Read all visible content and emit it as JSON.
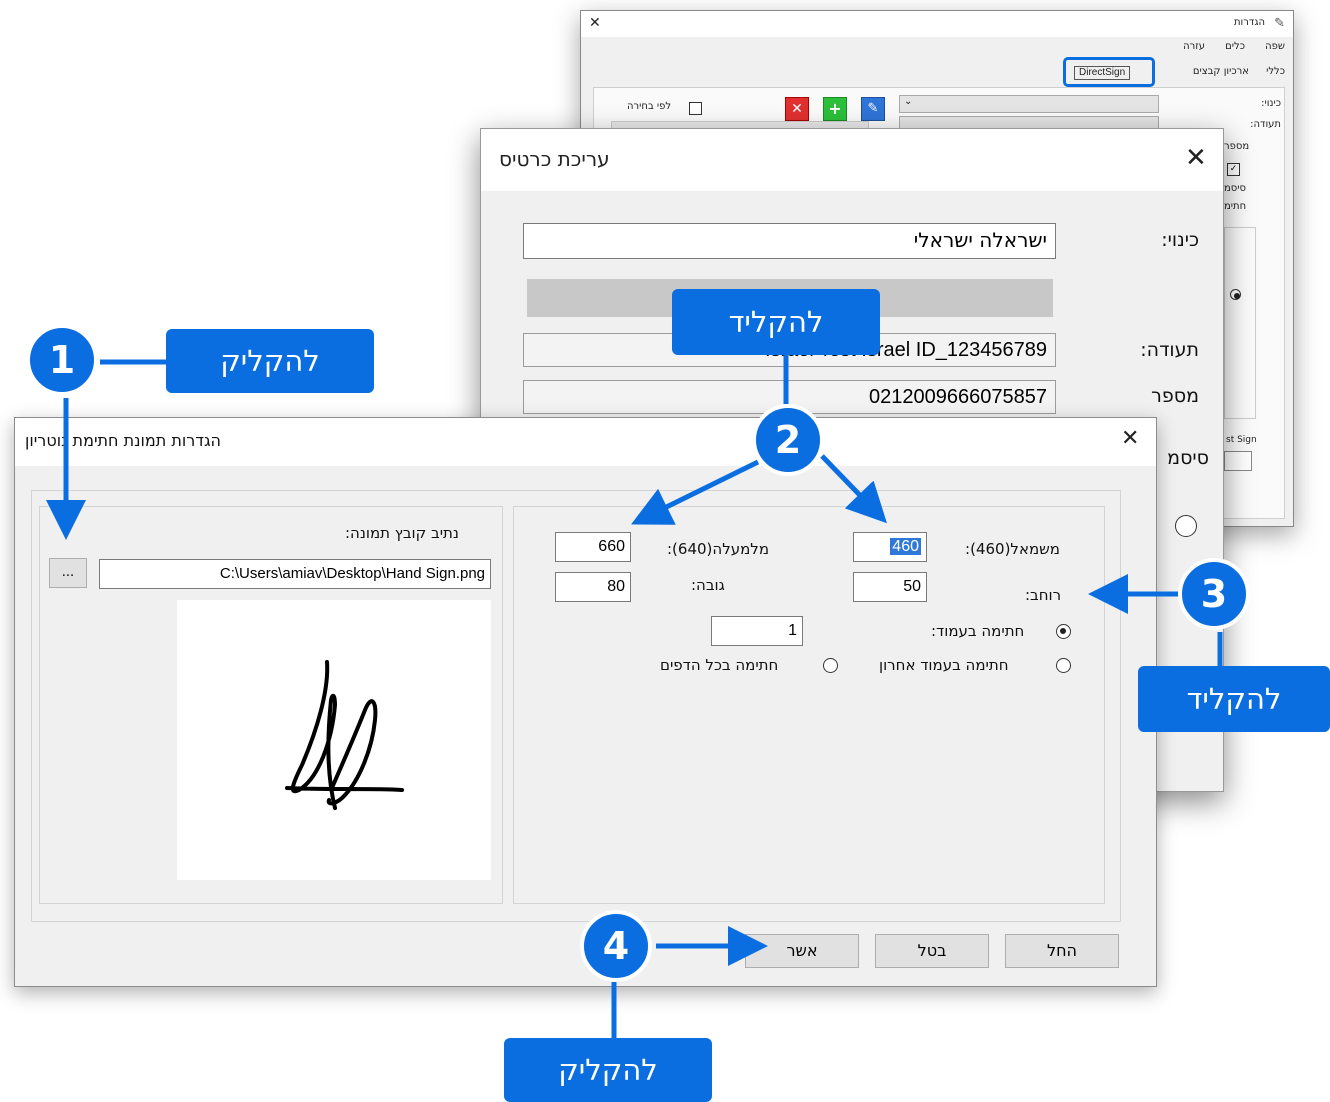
{
  "settings_window": {
    "title": "הגדרות",
    "menu": [
      "שפה",
      "כלים",
      "עזרה"
    ],
    "tabs": [
      "כללי",
      "ארכיון קבצים",
      "DirectSign"
    ],
    "labels": [
      "כינוי:",
      "תעודה:",
      "מספר",
      "סיסמ",
      "חתימ"
    ],
    "optional_label": "לפי בחירה",
    "partial_sign_text": "st Sign"
  },
  "edit_card": {
    "title": "עריכת כרטיס",
    "nickname_label": "כינוי:",
    "nickname_value": "ישראלה ישראלי",
    "certificate_label": "תעודה:",
    "certificate_value": "Israel Test Israel ID_123456789",
    "number_label": "מספר",
    "number_value": "0212009666075857",
    "password_label": "סיסמ"
  },
  "dialog": {
    "title": "הגדרות תמונת חתימת נוטריון",
    "path_label": "נתיב קובץ תמונה:",
    "path_value": "C:\\Users\\amiav\\Desktop\\Hand Sign.png",
    "browse_label": "...",
    "left_label": "משמאל(460):",
    "left_value": "460",
    "top_label": "מלמעלה(640):",
    "top_value": "660",
    "width_label": "רוחב:",
    "width_value": "50",
    "height_label": "גובה:",
    "height_value": "80",
    "sign_on_page_label": "חתימה בעמוד:",
    "page_value": "1",
    "sign_last_page_label": "חתימה בעמוד אחרון",
    "sign_all_pages_label": "חתימה בכל הדפים",
    "confirm_label": "אשר",
    "cancel_label": "בטל",
    "apply_label": "החל"
  },
  "callouts": {
    "step1": {
      "number": "1",
      "text": "להקליק"
    },
    "step2": {
      "number": "2",
      "text": "להקליד"
    },
    "step3": {
      "number": "3",
      "text": "להקליד"
    },
    "step4": {
      "number": "4",
      "text": "להקליק"
    }
  },
  "colors": {
    "accent": "#0b6ee0",
    "highlight": "#3078d8"
  }
}
